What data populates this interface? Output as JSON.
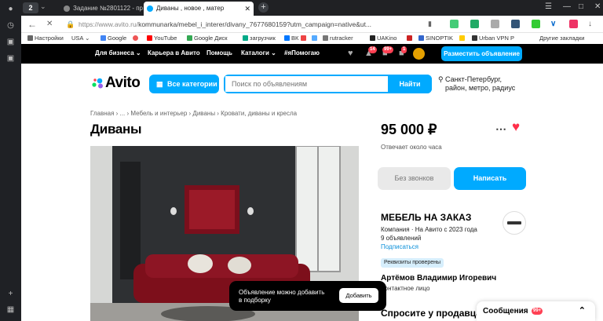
{
  "browser": {
    "tab_count": "2",
    "tabs": [
      {
        "label": "Задание №2801122 - про"
      },
      {
        "label": "Диваны , новое , матер"
      }
    ],
    "url_host": "https://www.avito.ru/",
    "url_path": "kommunarka/mebel_i_interer/divany_7677680159?utm_campaign=native&ut...",
    "bookmarks": [
      "Настройки",
      "USA",
      "Google",
      "YouTube",
      "Google Диск",
      "загрузчик",
      "ВК",
      "rutracker",
      "UAKino",
      "SINOPTIK",
      "Urban VPN P",
      "Другие закладки"
    ]
  },
  "topnav": {
    "items": [
      "Для бизнеса",
      "Карьера в Авито",
      "Помощь",
      "Каталоги",
      "#яПомогаю"
    ],
    "badges": [
      "14",
      "99+",
      "1"
    ],
    "post_ad": "Разместить объявление"
  },
  "header": {
    "logo": "Avito",
    "all_categories": "Все категории",
    "search_placeholder": "Поиск по объявлениям",
    "search_button": "Найти",
    "location_line1": "Санкт-Петербург,",
    "location_line2": "район, метро, радиус"
  },
  "breadcrumbs": "Главная › ... › Мебель и интерьер › Диваны › Кровати, диваны и кресла",
  "title": "Диваны",
  "listing": {
    "price": "95 000 ₽",
    "response_time": "Отвечает около часа",
    "no_calls": "Без звонков",
    "write": "Написать"
  },
  "seller": {
    "name": "МЕБЕЛЬ НА ЗАКАЗ",
    "meta": "Компания · На Авито с 2023 года",
    "ads_count": "9 объявлений",
    "subscribe": "Подписаться",
    "verified": "Реквизиты проверены",
    "person": "Артёмов Владимир Игоревич",
    "person_role": "Контактное лицо",
    "ask_heading": "Спросите у продавца"
  },
  "toast": {
    "line1": "Объявление можно добавить",
    "line2": "в подборку",
    "button": "Добавить"
  },
  "messages": {
    "label": "Сообщения",
    "count": "99+"
  }
}
